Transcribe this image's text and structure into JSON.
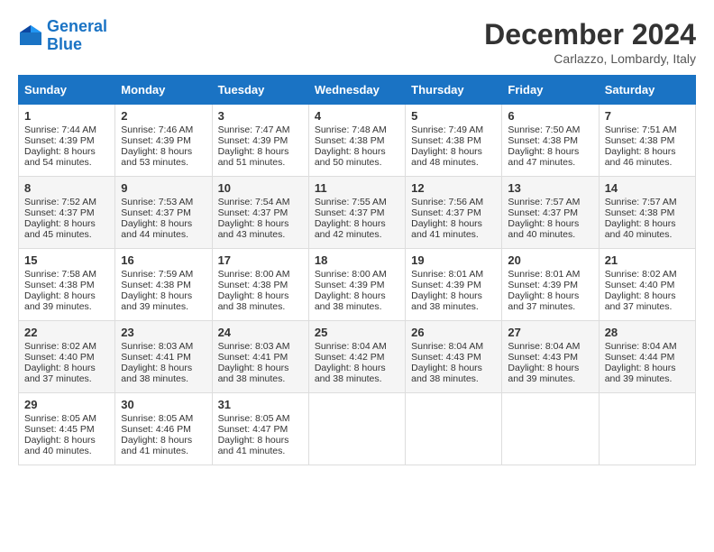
{
  "header": {
    "logo_line1": "General",
    "logo_line2": "Blue",
    "month": "December 2024",
    "location": "Carlazzo, Lombardy, Italy"
  },
  "days_of_week": [
    "Sunday",
    "Monday",
    "Tuesday",
    "Wednesday",
    "Thursday",
    "Friday",
    "Saturday"
  ],
  "weeks": [
    [
      {
        "day": 1,
        "sunrise": "7:44 AM",
        "sunset": "4:39 PM",
        "daylight": "8 hours and 54 minutes."
      },
      {
        "day": 2,
        "sunrise": "7:46 AM",
        "sunset": "4:39 PM",
        "daylight": "8 hours and 53 minutes."
      },
      {
        "day": 3,
        "sunrise": "7:47 AM",
        "sunset": "4:39 PM",
        "daylight": "8 hours and 51 minutes."
      },
      {
        "day": 4,
        "sunrise": "7:48 AM",
        "sunset": "4:38 PM",
        "daylight": "8 hours and 50 minutes."
      },
      {
        "day": 5,
        "sunrise": "7:49 AM",
        "sunset": "4:38 PM",
        "daylight": "8 hours and 48 minutes."
      },
      {
        "day": 6,
        "sunrise": "7:50 AM",
        "sunset": "4:38 PM",
        "daylight": "8 hours and 47 minutes."
      },
      {
        "day": 7,
        "sunrise": "7:51 AM",
        "sunset": "4:38 PM",
        "daylight": "8 hours and 46 minutes."
      }
    ],
    [
      {
        "day": 8,
        "sunrise": "7:52 AM",
        "sunset": "4:37 PM",
        "daylight": "8 hours and 45 minutes."
      },
      {
        "day": 9,
        "sunrise": "7:53 AM",
        "sunset": "4:37 PM",
        "daylight": "8 hours and 44 minutes."
      },
      {
        "day": 10,
        "sunrise": "7:54 AM",
        "sunset": "4:37 PM",
        "daylight": "8 hours and 43 minutes."
      },
      {
        "day": 11,
        "sunrise": "7:55 AM",
        "sunset": "4:37 PM",
        "daylight": "8 hours and 42 minutes."
      },
      {
        "day": 12,
        "sunrise": "7:56 AM",
        "sunset": "4:37 PM",
        "daylight": "8 hours and 41 minutes."
      },
      {
        "day": 13,
        "sunrise": "7:57 AM",
        "sunset": "4:37 PM",
        "daylight": "8 hours and 40 minutes."
      },
      {
        "day": 14,
        "sunrise": "7:57 AM",
        "sunset": "4:38 PM",
        "daylight": "8 hours and 40 minutes."
      }
    ],
    [
      {
        "day": 15,
        "sunrise": "7:58 AM",
        "sunset": "4:38 PM",
        "daylight": "8 hours and 39 minutes."
      },
      {
        "day": 16,
        "sunrise": "7:59 AM",
        "sunset": "4:38 PM",
        "daylight": "8 hours and 39 minutes."
      },
      {
        "day": 17,
        "sunrise": "8:00 AM",
        "sunset": "4:38 PM",
        "daylight": "8 hours and 38 minutes."
      },
      {
        "day": 18,
        "sunrise": "8:00 AM",
        "sunset": "4:39 PM",
        "daylight": "8 hours and 38 minutes."
      },
      {
        "day": 19,
        "sunrise": "8:01 AM",
        "sunset": "4:39 PM",
        "daylight": "8 hours and 38 minutes."
      },
      {
        "day": 20,
        "sunrise": "8:01 AM",
        "sunset": "4:39 PM",
        "daylight": "8 hours and 37 minutes."
      },
      {
        "day": 21,
        "sunrise": "8:02 AM",
        "sunset": "4:40 PM",
        "daylight": "8 hours and 37 minutes."
      }
    ],
    [
      {
        "day": 22,
        "sunrise": "8:02 AM",
        "sunset": "4:40 PM",
        "daylight": "8 hours and 37 minutes."
      },
      {
        "day": 23,
        "sunrise": "8:03 AM",
        "sunset": "4:41 PM",
        "daylight": "8 hours and 38 minutes."
      },
      {
        "day": 24,
        "sunrise": "8:03 AM",
        "sunset": "4:41 PM",
        "daylight": "8 hours and 38 minutes."
      },
      {
        "day": 25,
        "sunrise": "8:04 AM",
        "sunset": "4:42 PM",
        "daylight": "8 hours and 38 minutes."
      },
      {
        "day": 26,
        "sunrise": "8:04 AM",
        "sunset": "4:43 PM",
        "daylight": "8 hours and 38 minutes."
      },
      {
        "day": 27,
        "sunrise": "8:04 AM",
        "sunset": "4:43 PM",
        "daylight": "8 hours and 39 minutes."
      },
      {
        "day": 28,
        "sunrise": "8:04 AM",
        "sunset": "4:44 PM",
        "daylight": "8 hours and 39 minutes."
      }
    ],
    [
      {
        "day": 29,
        "sunrise": "8:05 AM",
        "sunset": "4:45 PM",
        "daylight": "8 hours and 40 minutes."
      },
      {
        "day": 30,
        "sunrise": "8:05 AM",
        "sunset": "4:46 PM",
        "daylight": "8 hours and 41 minutes."
      },
      {
        "day": 31,
        "sunrise": "8:05 AM",
        "sunset": "4:47 PM",
        "daylight": "8 hours and 41 minutes."
      },
      null,
      null,
      null,
      null
    ]
  ]
}
